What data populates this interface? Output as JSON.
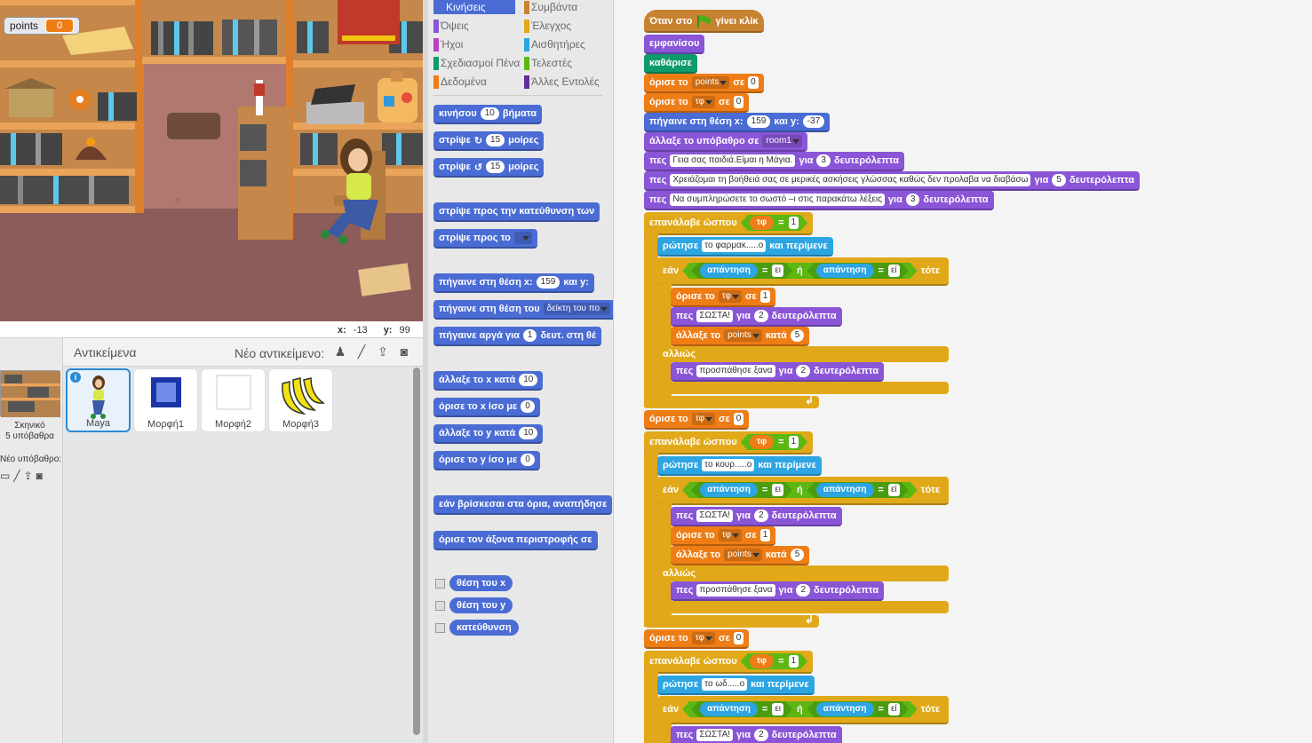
{
  "stage": {
    "monitor": {
      "label": "points",
      "value": "0"
    },
    "mouse_x_label": "x:",
    "mouse_x": "-13",
    "mouse_y_label": "y:",
    "mouse_y": "99"
  },
  "sprites_pane": {
    "title": "Αντικείμενα",
    "new_sprite_label": "Νέο αντικείμενο:",
    "backdrop": {
      "name": "Σκηνικό",
      "count": "5 υπόβαθρα"
    },
    "new_backdrop_label": "Νέο υπόβαθρο:",
    "sprites": [
      "Maya",
      "Μορφή1",
      "Μορφή2",
      "Μορφή3"
    ]
  },
  "palette": {
    "categories": [
      {
        "label": "Κινήσεις",
        "color": "#4a6cd4"
      },
      {
        "label": "Συμβάντα",
        "color": "#c88330"
      },
      {
        "label": "Όψεις",
        "color": "#8a55d7"
      },
      {
        "label": "Έλεγχος",
        "color": "#e1a91a"
      },
      {
        "label": "Ήχοι",
        "color": "#bb42c3"
      },
      {
        "label": "Αισθητήρες",
        "color": "#2ca5e2"
      },
      {
        "label": "Σχεδιασμοί Πένα",
        "color": "#0e9a6c"
      },
      {
        "label": "Τελεστές",
        "color": "#5cb712"
      },
      {
        "label": "Δεδομένα",
        "color": "#ee7d16"
      },
      {
        "label": "Άλλες Εντολές",
        "color": "#632d99"
      }
    ],
    "blocks": {
      "move": [
        "κινήσου",
        "10",
        "βήματα"
      ],
      "turn_cw": [
        "στρίψε",
        "↻",
        "15",
        "μοίρες"
      ],
      "turn_ccw": [
        "στρίψε",
        "↺",
        "15",
        "μοίρες"
      ],
      "point_dir": "στρίψε προς την κατεύθυνση των",
      "point_to": "στρίψε προς το",
      "goto_xy": [
        "πήγαινε στη θέση x:",
        "159",
        "και y:"
      ],
      "goto": [
        "πήγαινε στη θέση του",
        "δείκτη του πο"
      ],
      "glide": [
        "πήγαινε αργά για",
        "1",
        "δευτ. στη θέ"
      ],
      "change_x": [
        "άλλαξε το x κατά",
        "10"
      ],
      "set_x": [
        "όρισε το x ίσο με",
        "0"
      ],
      "change_y": [
        "άλλαξε το y κατά",
        "10"
      ],
      "set_y": [
        "όρισε το y ίσο με",
        "0"
      ],
      "bounce": "εάν βρίσκεσαι στα όρια, αναπήδησε",
      "rot_style": "όρισε τον άξονα περιστροφής σε",
      "xpos": "θέση του x",
      "ypos": "θέση του y",
      "direction": "κατεύθυνση"
    }
  },
  "script": {
    "when_flag": [
      "Όταν στο",
      "γίνει κλίκ"
    ],
    "show": "εμφανίσου",
    "clear": "καθάρισε",
    "set": "όρισε το",
    "to": "σε",
    "var_points": "points",
    "var_tf": "τφ",
    "zero": "0",
    "one": "1",
    "goto_xy": [
      "πήγαινε στη θέση x:",
      "159",
      "και y:",
      "-37"
    ],
    "switch_backdrop": [
      "άλλαξε το υπόβαθρο σε",
      "room1"
    ],
    "say1": [
      "πες",
      "Γεια σας παιδιά.Είμαι η Μάγια.",
      "για",
      "3",
      "δευτερόλεπτα"
    ],
    "say2": [
      "πες",
      "Χρειάζομαι τη βοήθειά σας σε μερικές ασκήσεις γλώσσας καθώς δεν προλαβα να διαβάσω",
      "για",
      "5",
      "δευτερόλεπτα"
    ],
    "say3": [
      "πες",
      "Να συμπληρώσετε το σωστό –ι στις παρακάτω λέξεις",
      "για",
      "3",
      "δευτερόλεπτα"
    ],
    "repeat_until": "επανάλαβε ώσπου",
    "eq": "=",
    "ask_and_wait": "και περίμενε",
    "ask": "ρώτησε",
    "q1": "το φαρμακ.....ο",
    "q2": "το κουρ.....ο",
    "q3": "το ωδ.....ο",
    "if": "εάν",
    "then": "τότε",
    "or": "ή",
    "answer": "απάντηση",
    "ans1": "ει",
    "ans2": "εί",
    "else": "αλλιώς",
    "say": "πες",
    "correct": "ΣΩΣΤΑ!",
    "for": "για",
    "two": "2",
    "five": "5",
    "seconds": "δευτερόλεπτα",
    "change": "άλλαξε το",
    "by": "κατά",
    "try_again": "προσπάθησε ξανα"
  }
}
